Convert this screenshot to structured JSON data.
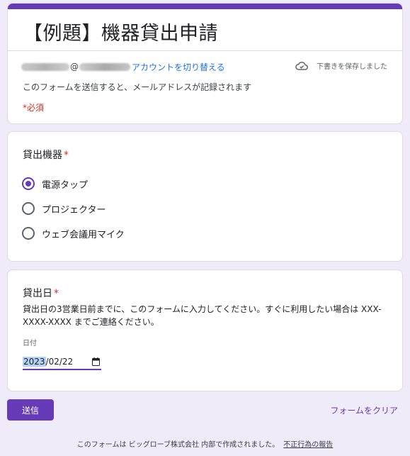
{
  "form": {
    "title": "【例題】機器貸出申請",
    "account": {
      "at_sign": "@",
      "switch_label": "アカウントを切り替える"
    },
    "draft_status": "下書きを保存しました",
    "email_note": "このフォームを送信すると、メールアドレスが記録されます",
    "required_note": "*必須"
  },
  "questions": [
    {
      "title": "貸出機器",
      "required_mark": "*",
      "options": [
        {
          "label": "電源タップ",
          "selected": true
        },
        {
          "label": "プロジェクター",
          "selected": false
        },
        {
          "label": "ウェブ会議用マイク",
          "selected": false
        }
      ]
    },
    {
      "title": "貸出日",
      "required_mark": "*",
      "description": "貸出日の3営業日前までに、このフォームに入力してください。すぐに利用したい場合は XXX-XXXX-XXXX までご連絡ください。",
      "date_label": "日付",
      "date_year": "2023",
      "date_rest": "/02/22"
    }
  ],
  "footer": {
    "submit_label": "送信",
    "clear_label": "フォームをクリア",
    "note": "このフォームは ビッグローブ株式会社 内部で作成されました。",
    "report_label": "不正行為の報告"
  },
  "colors": {
    "accent": "#673ab7",
    "background": "#efebf8",
    "link": "#1a73e8",
    "required": "#d93025"
  },
  "icons": {
    "draft": "cloud-check-icon",
    "date": "calendar-icon"
  }
}
